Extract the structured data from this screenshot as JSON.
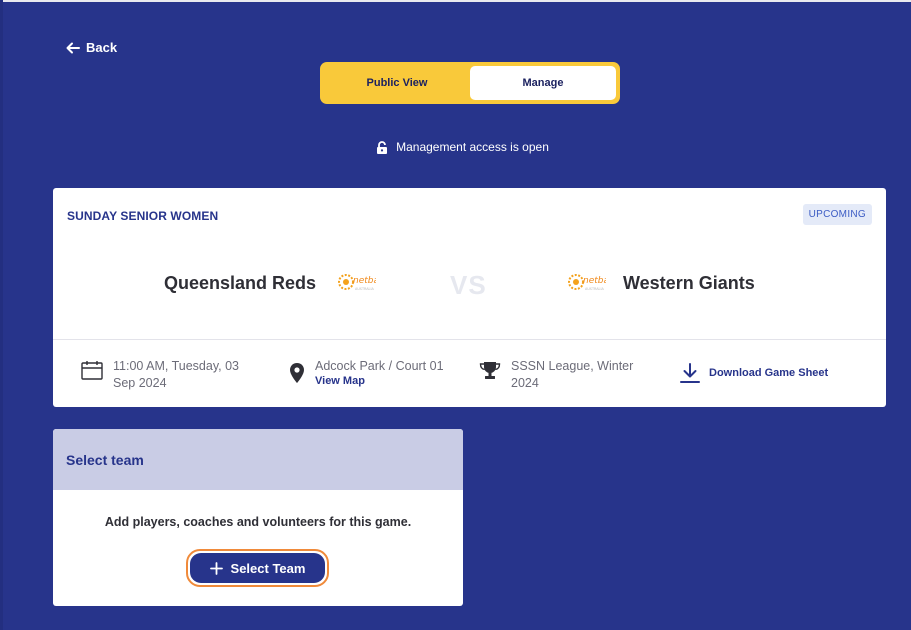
{
  "back": {
    "label": "Back"
  },
  "toggle": {
    "options": [
      "Public View",
      "Manage"
    ],
    "active": "Manage"
  },
  "access": {
    "text": "Management access is open"
  },
  "game": {
    "competition": "SUNDAY SENIOR WOMEN",
    "status": "UPCOMING",
    "home_team": "Queensland Reds",
    "away_team": "Western Giants",
    "vs": "VS",
    "logo_text": "netball",
    "logo_sub": "AUSTRALIA",
    "datetime": "11:00 AM, Tuesday, 03 Sep 2024",
    "venue": "Adcock Park / Court 01",
    "view_map": "View Map",
    "league": "SSSN League, Winter 2024",
    "download": "Download Game Sheet"
  },
  "select_team": {
    "title": "Select team",
    "message": "Add players, coaches and volunteers for this game.",
    "button": "Select Team"
  },
  "colors": {
    "background": "#27348b",
    "accent_yellow": "#f9c93a",
    "focus_orange": "#f08a3a",
    "badge_bg": "#e4eaf8"
  }
}
